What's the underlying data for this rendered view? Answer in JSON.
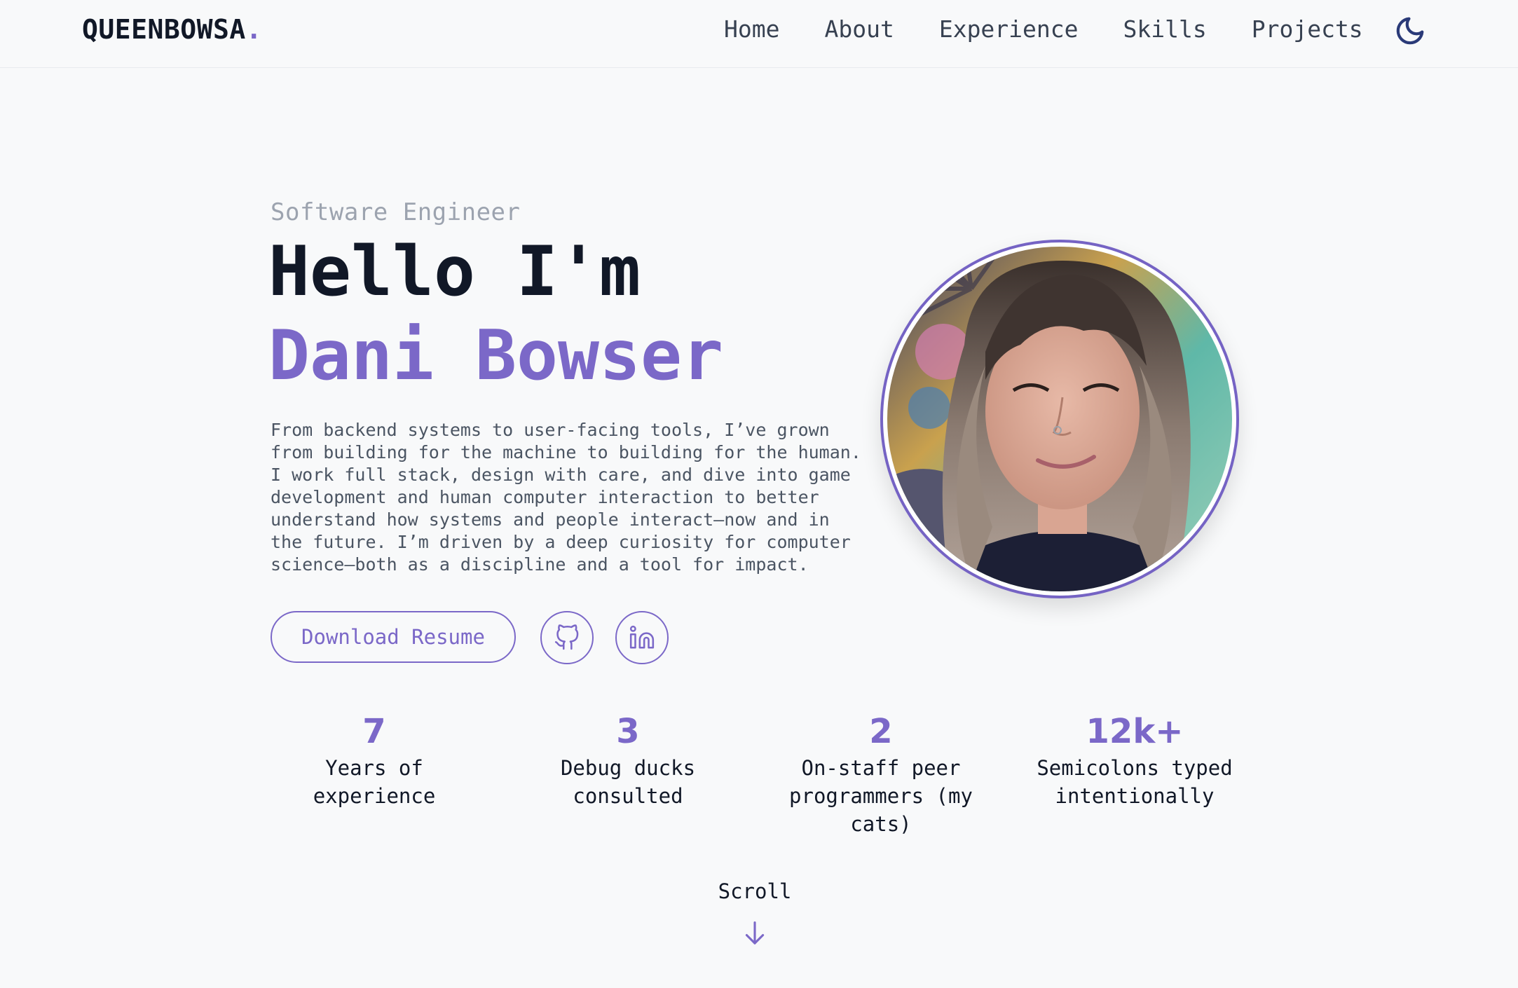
{
  "header": {
    "logo_text": "QUEENBOWSA",
    "logo_dot": ".",
    "nav": [
      "Home",
      "About",
      "Experience",
      "Skills",
      "Projects"
    ],
    "theme_icon": "moon-icon"
  },
  "hero": {
    "role": "Software Engineer",
    "greeting": "Hello I'm",
    "name": "Dani Bowser",
    "bio": "From backend systems to user-facing tools, I’ve grown from building for the machine to building for the human. I work full stack, design with care, and dive into game development and human computer interaction to better understand how systems and people interact—now and in the future. I’m driven by a deep curiosity for computer science—both as a discipline and a tool for impact.",
    "resume_button": "Download Resume",
    "social_icons": [
      "github-icon",
      "linkedin-icon"
    ]
  },
  "stats": [
    {
      "value": "7",
      "label": "Years of experience"
    },
    {
      "value": "3",
      "label": "Debug ducks consulted"
    },
    {
      "value": "2",
      "label": "On-staff peer programmers (my cats)"
    },
    {
      "value": "12k+",
      "label": "Semicolons typed intentionally"
    }
  ],
  "scroll": {
    "label": "Scroll",
    "icon": "arrow-down-icon"
  },
  "colors": {
    "accent": "#7b68c8",
    "background": "#f8f9fa",
    "text": "#111827",
    "muted": "#9ca3af",
    "moon": "#2a3a78"
  }
}
